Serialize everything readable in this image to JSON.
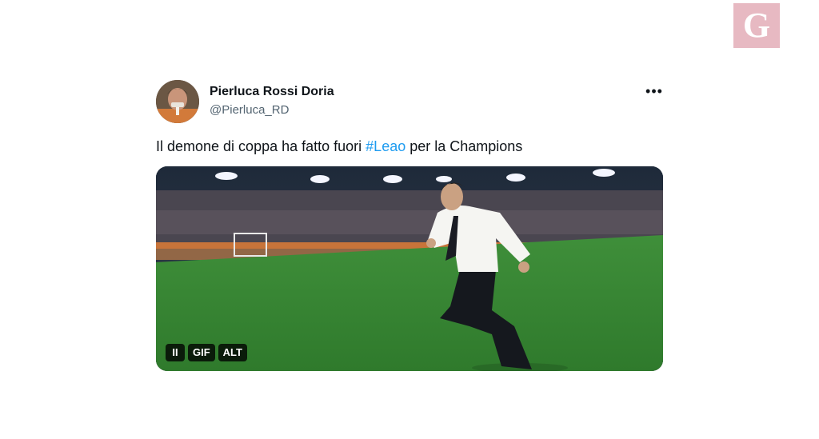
{
  "brand": {
    "logo_letter": "G",
    "logo_color": "#e7b9c2"
  },
  "tweet": {
    "author_name": "Pierluca Rossi Doria",
    "author_handle": "@Pierluca_RD",
    "text_before": "Il demone di coppa ha fatto fuori ",
    "hashtag": "#Leao",
    "text_after": " per la Champions",
    "hashtag_color": "#1d9bf0",
    "more_icon": "more-horizontal-icon"
  },
  "media": {
    "pause_label": "II",
    "gif_label": "GIF",
    "alt_label": "ALT"
  }
}
